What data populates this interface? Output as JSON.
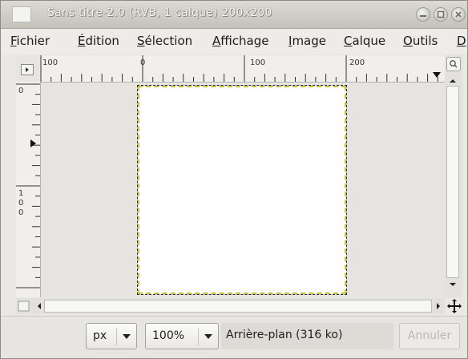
{
  "window": {
    "title": "Sans titre-2.0 (RVB, 1 calque) 200x200"
  },
  "menubar": {
    "items": [
      {
        "label": "Fichier",
        "mnemonic": "F",
        "rest": "ichier"
      },
      {
        "label": "Édition",
        "mnemonic": "É",
        "rest": "dition"
      },
      {
        "label": "Sélection",
        "mnemonic": "S",
        "rest": "élection"
      },
      {
        "label": "Affichage",
        "mnemonic": "A",
        "rest": "ffichage"
      },
      {
        "label": "Image",
        "mnemonic": "I",
        "rest": "mage"
      },
      {
        "label": "Calque",
        "mnemonic": "C",
        "rest": "alque"
      },
      {
        "label": "Outils",
        "mnemonic": "O",
        "rest": "utils"
      },
      {
        "label": "D",
        "mnemonic": "D",
        "rest": ""
      }
    ]
  },
  "rulers": {
    "top_labels": [
      "100",
      "0",
      "100",
      "200"
    ],
    "left_labels": [
      "0",
      "1",
      "0",
      "0"
    ]
  },
  "statusbar": {
    "unit": "px",
    "zoom": "100%",
    "message": "Arrière-plan (316 ko)",
    "cancel_label": "Annuler"
  },
  "colors": {
    "selection_border": "#c9c23b",
    "canvas": "#ffffff",
    "chrome": "#e9e8e4"
  },
  "icons": {
    "window_buttons": [
      "minimize-icon",
      "maximize-icon",
      "close-icon"
    ],
    "navigation": "move-cross-icon"
  }
}
